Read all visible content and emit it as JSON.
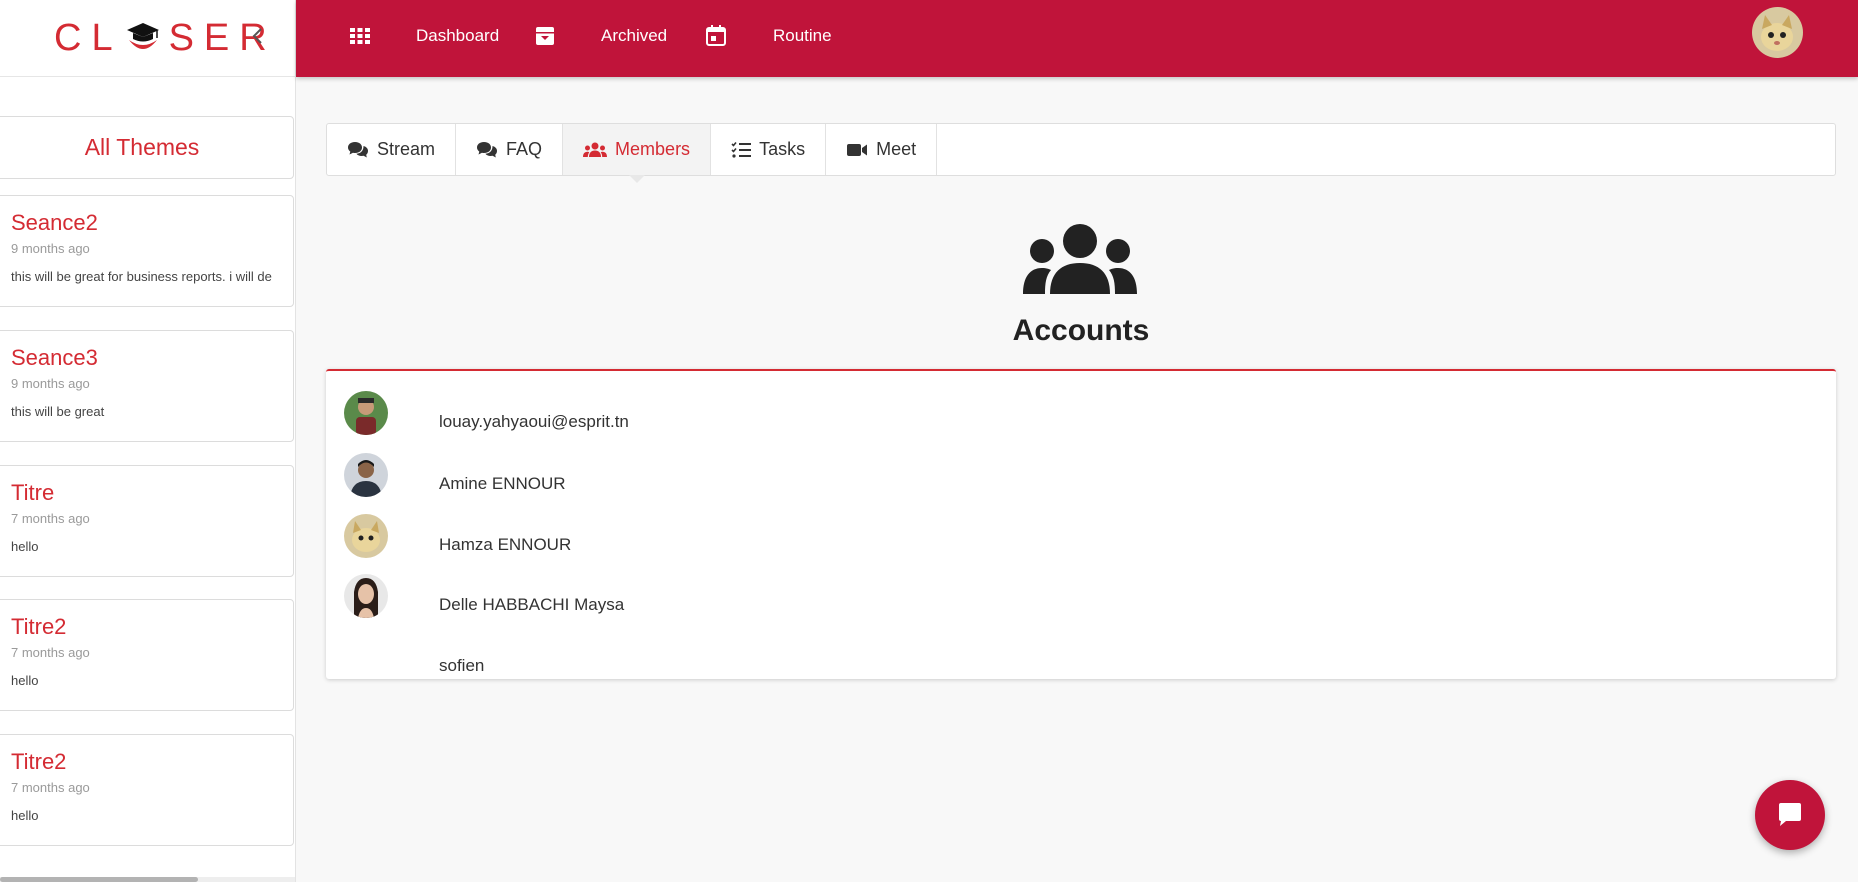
{
  "app": {
    "logo_text_left": "CL",
    "logo_text_right": "SER"
  },
  "topnav": {
    "items": [
      {
        "label": "Dashboard",
        "icon": "grid-icon"
      },
      {
        "label": "Archived",
        "icon": "archive-icon"
      },
      {
        "label": "Routine",
        "icon": "calendar-icon"
      }
    ]
  },
  "sidebar": {
    "all_themes_label": "All Themes",
    "themes": [
      {
        "title": "Seance2",
        "date": "9 months ago",
        "desc": "this will be great for business reports. i will de"
      },
      {
        "title": "Seance3",
        "date": "9 months ago",
        "desc": "this will be great"
      },
      {
        "title": "Titre",
        "date": "7 months ago",
        "desc": "hello"
      },
      {
        "title": "Titre2",
        "date": "7 months ago",
        "desc": "hello"
      },
      {
        "title": "Titre2",
        "date": "7 months ago",
        "desc": "hello"
      }
    ]
  },
  "tabs": [
    {
      "label": "Stream",
      "icon": "comments-icon",
      "active": false
    },
    {
      "label": "FAQ",
      "icon": "comments-icon",
      "active": false
    },
    {
      "label": "Members",
      "icon": "users-icon",
      "active": true
    },
    {
      "label": "Tasks",
      "icon": "tasks-icon",
      "active": false
    },
    {
      "label": "Meet",
      "icon": "video-icon",
      "active": false
    }
  ],
  "accounts": {
    "title": "Accounts",
    "members": [
      {
        "name": "louay.yahyaoui@esprit.tn",
        "has_avatar": true
      },
      {
        "name": "Amine ENNOUR",
        "has_avatar": true
      },
      {
        "name": "Hamza ENNOUR",
        "has_avatar": true
      },
      {
        "name": "Delle HABBACHI Maysa",
        "has_avatar": true
      },
      {
        "name": "sofien",
        "has_avatar": false
      }
    ]
  },
  "colors": {
    "brand": "#c0143a",
    "accent_red": "#d42b33",
    "background": "#f8f8f8"
  }
}
